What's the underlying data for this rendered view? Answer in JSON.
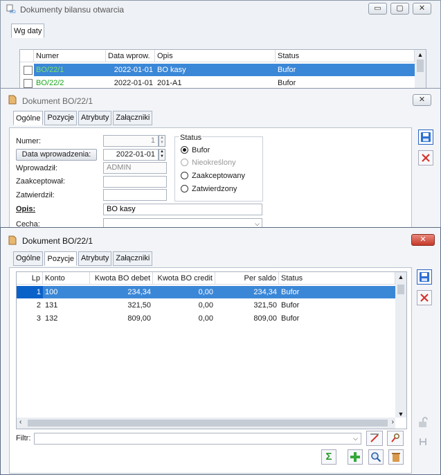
{
  "win1": {
    "title": "Dokumenty bilansu otwarcia",
    "tab": "Wg daty",
    "columns": [
      "Numer",
      "Data wprow.",
      "Opis",
      "Status"
    ],
    "rows": [
      {
        "numer": "BO/22/1",
        "data": "2022-01-01",
        "opis": "BO kasy",
        "status": "Bufor"
      },
      {
        "numer": "BO/22/2",
        "data": "2022-01-01",
        "opis": "201-A1",
        "status": "Bufor"
      }
    ]
  },
  "win2": {
    "title": "Dokument BO/22/1",
    "tabs": [
      "Ogólne",
      "Pozycje",
      "Atrybuty",
      "Załączniki"
    ],
    "numer_label": "Numer:",
    "numer_value": "1",
    "data_button": "Data wprowadzenia:",
    "data_value": "2022-01-01",
    "wprowadzil_label": "Wprowadził:",
    "wprowadzil_value": "ADMIN",
    "zaakceptowal_label": "Zaakceptował:",
    "zatwierdzil_label": "Zatwierdził:",
    "opis_label": "Opis:",
    "opis_value": "BO kasy",
    "cecha_label": "Cecha:",
    "status_title": "Status",
    "status_options": [
      "Bufor",
      "Nieokreślony",
      "Zaakceptowany",
      "Zatwierdzony"
    ]
  },
  "win3": {
    "title": "Dokument BO/22/1",
    "tabs": [
      "Ogólne",
      "Pozycje",
      "Atrybuty",
      "Załączniki"
    ],
    "columns": [
      "Lp",
      "Konto",
      "Kwota BO debet",
      "Kwota BO credit",
      "Per saldo",
      "Status"
    ],
    "rows": [
      {
        "lp": "1",
        "konto": "100",
        "debet": "234,34",
        "credit": "0,00",
        "saldo": "234,34",
        "status": "Bufor"
      },
      {
        "lp": "2",
        "konto": "131",
        "debet": "321,50",
        "credit": "0,00",
        "saldo": "321,50",
        "status": "Bufor"
      },
      {
        "lp": "3",
        "konto": "132",
        "debet": "809,00",
        "credit": "0,00",
        "saldo": "809,00",
        "status": "Bufor"
      }
    ],
    "filter_label": "Filtr:"
  },
  "colors": {
    "selection": "#3b87d7",
    "close_red": "#d9534f",
    "green_text": "#17a51a"
  }
}
